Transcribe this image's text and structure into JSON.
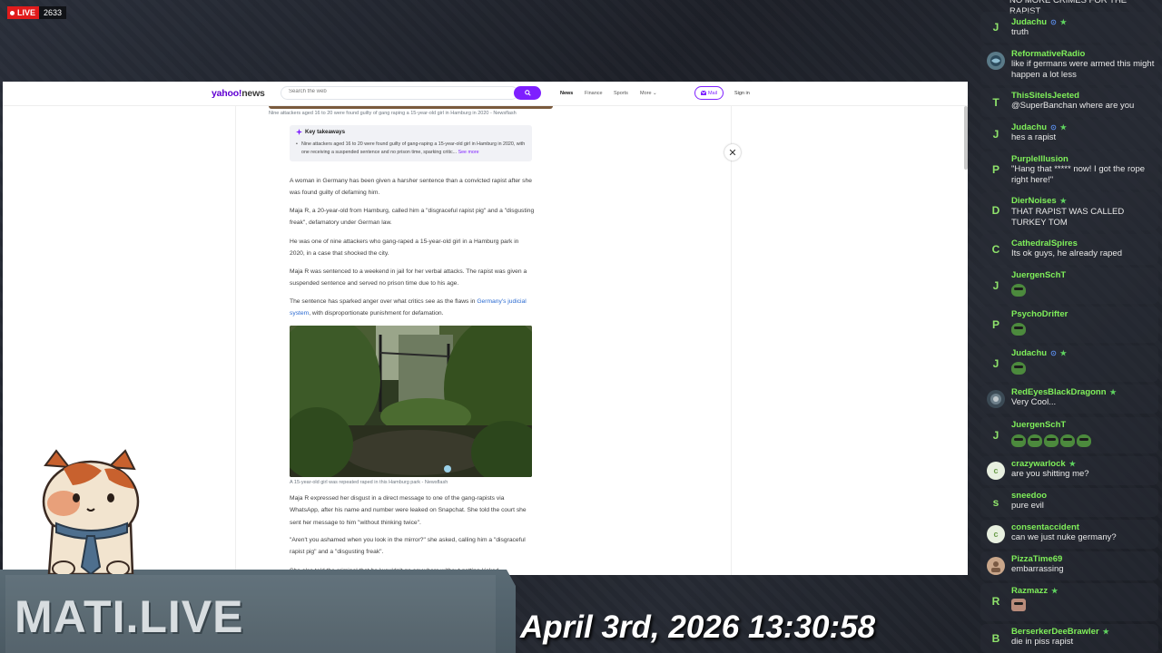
{
  "stream": {
    "live_label": "LIVE",
    "viewer_count": "2633",
    "brand": "MATI.LIVE",
    "datetime": "April 3rd, 2026 13:30:58"
  },
  "yahoo": {
    "logo_main": "yahoo!",
    "logo_sub": "news",
    "search_placeholder": "Search the web",
    "nav": [
      "News",
      "Finance",
      "Sports",
      "More ⌄"
    ],
    "mail_label": "Mail",
    "signin_label": "Sign in"
  },
  "article": {
    "top_caption": "Nine attackers aged 16 to 20 were found guilty of gang raping a 15-year-old girl in Hamburg in 2020 - Newsflash",
    "takeaways_title": "Key takeaways",
    "takeaways_text": "Nine attackers aged 16 to 20 were found guilty of gang-raping a 15-year-old girl in Hamburg in 2020, with one receiving a suspended sentence and no prison time, sparking critic...",
    "see_more": "See more",
    "paragraphs": [
      "A woman in Germany has been given a harsher sentence than a convicted rapist after she was found guilty of defaming him.",
      "Maja R, a 20-year-old from Hamburg, called him a \"disgraceful rapist pig\" and a \"disgusting freak\", defamatory under German law.",
      "He was one of nine attackers who gang-raped a 15-year-old girl in a Hamburg park in 2020, in a case that shocked the city.",
      "Maja R was sentenced to a weekend in jail for her verbal attacks. The rapist was given a suspended sentence and served no prison time due to his age."
    ],
    "para5_before": "The sentence has sparked anger over what critics see as the flaws in ",
    "para5_link": "Germany's judicial system",
    "para5_after": ", with disproportionate punishment for defamation.",
    "photo_caption": "A 15-year-old girl was repeated raped in this Hamburg park - Newsflash",
    "paragraphs_after": [
      "Maja R expressed her disgust in a direct message to one of the gang-rapists via WhatsApp, after his name and number were leaked on Snapchat. She told the court she sent her message to him \"without thinking twice\".",
      "\"Aren't you ashamed when you look in the mirror?\" she asked, calling him a \"disgraceful rapist pig\" and a \"disgusting freak\".",
      "She also told the criminal that he 'wouldn't go anywhere without getting kicked"
    ]
  },
  "chat": {
    "top_partial": "NO MORE CRIMES FOR THE RAPIST",
    "messages": [
      {
        "user": "Judachu",
        "avatar": "J",
        "text": "truth"
      },
      {
        "user": "ReformativeRadio",
        "avatar": "",
        "text": "like if germans were armed this might happen a lot less"
      },
      {
        "user": "ThisSiteIsJeeted",
        "avatar": "T",
        "text": "@SuperBanchan where are you"
      },
      {
        "user": "Judachu",
        "avatar": "J",
        "text": "hes a rapist"
      },
      {
        "user": "PurpleIllusion",
        "avatar": "P",
        "text": "\"Hang that ***** now! I got the rope right here!\""
      },
      {
        "user": "DierNoises",
        "avatar": "D",
        "text": "THAT RAPIST WAS CALLED TURKEY TOM"
      },
      {
        "user": "CathedralSpires",
        "avatar": "C",
        "text": "Its ok guys, he already raped"
      },
      {
        "user": "JuergenSchT",
        "avatar": "J",
        "text": ""
      },
      {
        "user": "PsychoDrifter",
        "avatar": "P",
        "text": ""
      },
      {
        "user": "Judachu",
        "avatar": "J",
        "text": ""
      },
      {
        "user": "RedEyesBlackDragonn",
        "avatar": "",
        "text": "Very Cool..."
      },
      {
        "user": "JuergenSchT",
        "avatar": "J",
        "text": ""
      },
      {
        "user": "crazywarlock",
        "avatar": "c",
        "text": "are you shitting me?"
      },
      {
        "user": "sneedoo",
        "avatar": "s",
        "text": "pure evil"
      },
      {
        "user": "consentaccident",
        "avatar": "c",
        "text": "can we just nuke germany?"
      },
      {
        "user": "PizzaTime69",
        "avatar": "",
        "text": "embarrassing"
      },
      {
        "user": "Razmazz",
        "avatar": "R",
        "text": ""
      },
      {
        "user": "BerserkerDeeBrawler",
        "avatar": "B",
        "text": "die in piss rapist"
      }
    ]
  },
  "colors": {
    "yahoo_purple": "#7e1fff",
    "chat_name_green": "#7ff05a",
    "live_red": "#e01b1b"
  }
}
